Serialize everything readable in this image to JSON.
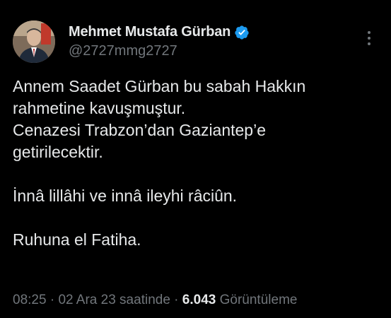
{
  "author": {
    "name": "Mehmet Mustafa Gürban",
    "handle": "@2727mmg2727",
    "avatar_icon": "user-avatar",
    "verified_icon": "verified-badge-icon"
  },
  "tweet": {
    "line1": "Annem Saadet Gürban bu sabah Hakkın",
    "line2": "rahmetine kavuşmuştur.",
    "line3": "Cenazesi Trabzon’dan Gaziantep’e",
    "line4": "getirilecektir.",
    "line5": "İnnâ lillâhi ve innâ ileyhi râciûn.",
    "line6": "Ruhuna el Fatiha."
  },
  "meta": {
    "time": "08:25",
    "sep1": " · ",
    "date": "02 Ara 23 saatinde",
    "sep2": " · ",
    "views_count": "6.043",
    "views_label": " Görüntüleme"
  },
  "colors": {
    "background": "#000000",
    "text": "#e7e9ea",
    "secondary": "#71767b",
    "verified": "#1d9bf0"
  }
}
